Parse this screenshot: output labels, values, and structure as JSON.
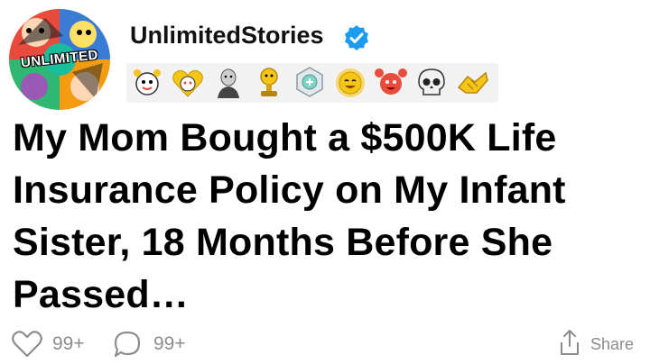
{
  "post": {
    "avatar_label": "UNLIMITED",
    "username": "UnlimitedStories",
    "verified": true,
    "awards": [
      "wholesome-seal-award",
      "heart-eyes-award",
      "bald-figure-award",
      "gold-trophy-award",
      "platinum-award",
      "sun-award",
      "love-hands-award",
      "skull-award",
      "handshake-award"
    ],
    "title_lines": [
      "My Mom Bought a $500K Life",
      "Insurance Policy on My Infant",
      "Sister, 18 Months Before She",
      "Passed…"
    ]
  },
  "footer": {
    "likes": "99+",
    "comments": "99+",
    "share_label": "Share"
  },
  "colors": {
    "verified_blue": "#1d9bf0",
    "muted": "#8c8c8c",
    "award_gold": "#f5c518"
  }
}
